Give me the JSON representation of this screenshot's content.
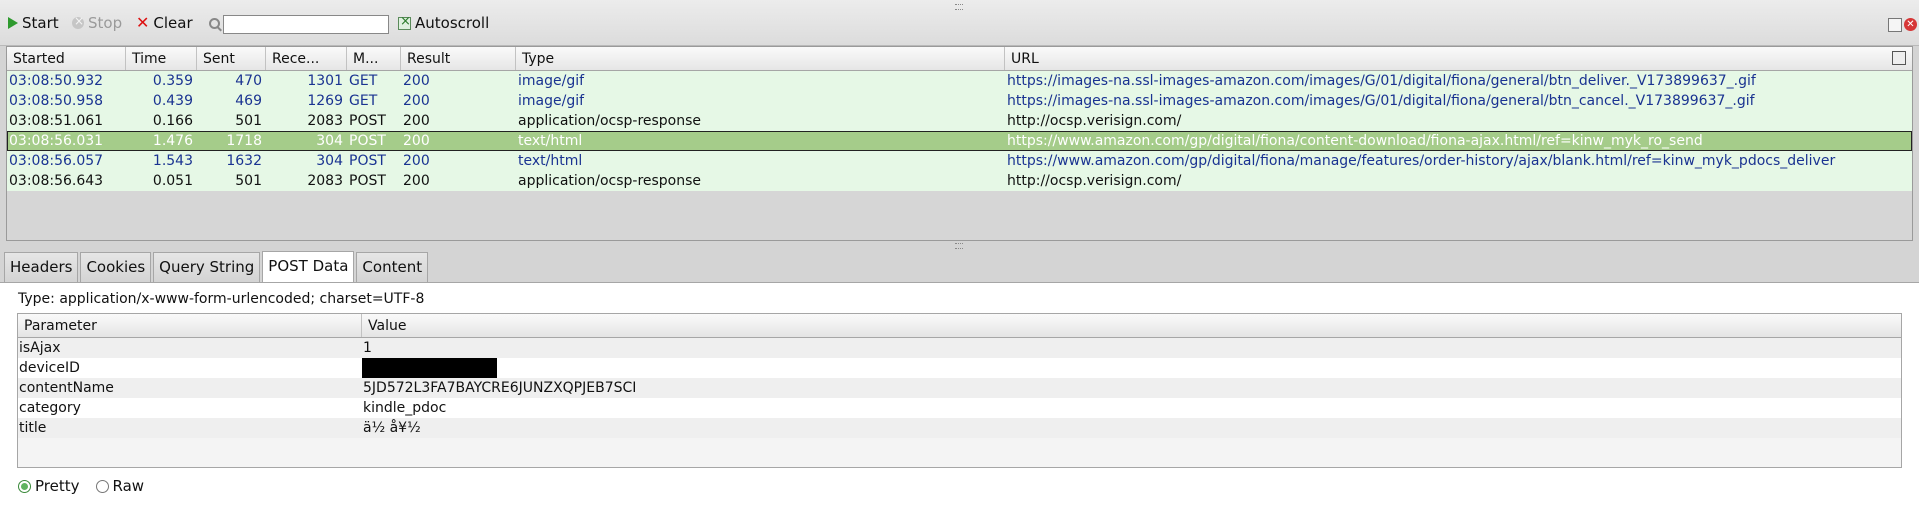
{
  "toolbar": {
    "start_label": "Start",
    "stop_label": "Stop",
    "clear_label": "Clear",
    "search_value": "",
    "autoscroll_label": "Autoscroll",
    "autoscroll_checked": true
  },
  "requests": {
    "columns": [
      "Started",
      "Time",
      "Sent",
      "Rece...",
      "M...",
      "Result",
      "Type",
      "URL"
    ],
    "rows": [
      {
        "started": "03:08:50.932",
        "time": "0.359",
        "sent": "470",
        "received": "1301",
        "method": "GET",
        "result": "200",
        "type": "image/gif",
        "url": "https://images-na.ssl-images-amazon.com/images/G/01/digital/fiona/general/btn_deliver._V173899637_.gif"
      },
      {
        "started": "03:08:50.958",
        "time": "0.439",
        "sent": "469",
        "received": "1269",
        "method": "GET",
        "result": "200",
        "type": "image/gif",
        "url": "https://images-na.ssl-images-amazon.com/images/G/01/digital/fiona/general/btn_cancel._V173899637_.gif"
      },
      {
        "started": "03:08:51.061",
        "time": "0.166",
        "sent": "501",
        "received": "2083",
        "method": "POST",
        "result": "200",
        "type": "application/ocsp-response",
        "url": "http://ocsp.verisign.com/"
      },
      {
        "started": "03:08:56.031",
        "time": "1.476",
        "sent": "1718",
        "received": "304",
        "method": "POST",
        "result": "200",
        "type": "text/html",
        "url": "https://www.amazon.com/gp/digital/fiona/content-download/fiona-ajax.html/ref=kinw_myk_ro_send"
      },
      {
        "started": "03:08:56.057",
        "time": "1.543",
        "sent": "1632",
        "received": "304",
        "method": "POST",
        "result": "200",
        "type": "text/html",
        "url": "https://www.amazon.com/gp/digital/fiona/manage/features/order-history/ajax/blank.html/ref=kinw_myk_pdocs_deliver"
      },
      {
        "started": "03:08:56.643",
        "time": "0.051",
        "sent": "501",
        "received": "2083",
        "method": "POST",
        "result": "200",
        "type": "application/ocsp-response",
        "url": "http://ocsp.verisign.com/"
      }
    ],
    "selected_index": 3
  },
  "tabs": [
    {
      "label": "Headers"
    },
    {
      "label": "Cookies"
    },
    {
      "label": "Query String"
    },
    {
      "label": "POST Data"
    },
    {
      "label": "Content"
    }
  ],
  "active_tab": 3,
  "post_data": {
    "type_line": "Type: application/x-www-form-urlencoded; charset=UTF-8",
    "param_header": "Parameter",
    "value_header": "Value",
    "params": [
      {
        "name": "isAjax",
        "value": "1"
      },
      {
        "name": "deviceID",
        "value": "",
        "redacted": true
      },
      {
        "name": "contentName",
        "value": "5JD572L3FA7BAYCRE6JUNZXQPJEB7SCI"
      },
      {
        "name": "category",
        "value": "kindle_pdoc"
      },
      {
        "name": "title",
        "value": "ä½ å¥½"
      }
    ]
  },
  "view_mode": {
    "pretty_label": "Pretty",
    "raw_label": "Raw",
    "selected": "Pretty"
  },
  "colors": {
    "row_bg": "#e6f8e6",
    "selected_row_bg": "#a5cc8a",
    "link_blue": "#1a3391"
  }
}
